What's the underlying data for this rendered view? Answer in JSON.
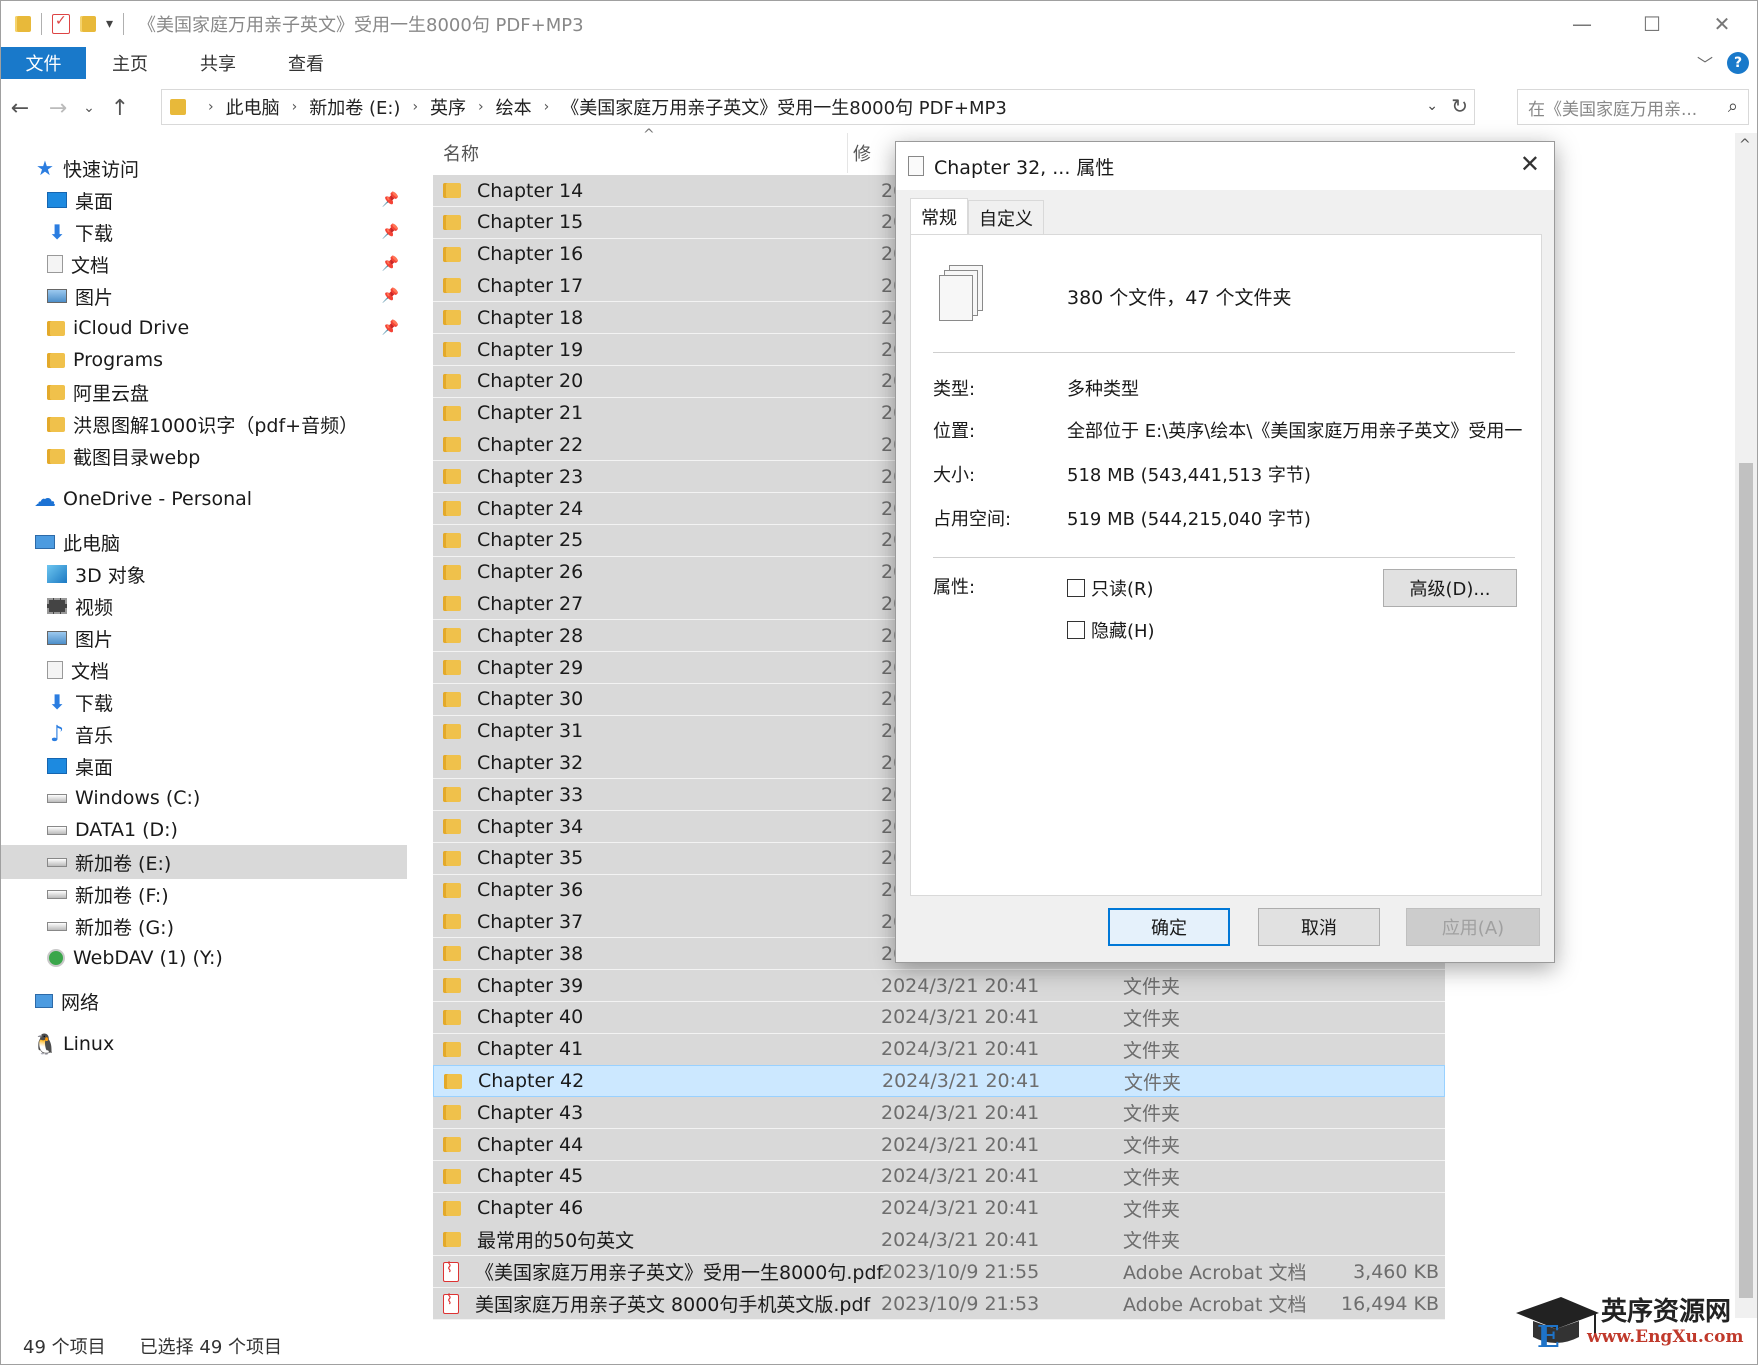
{
  "window": {
    "title": "《美国家庭万用亲子英文》受用一生8000句 PDF+MP3",
    "minimize": "—",
    "maximize": "☐",
    "close": "✕"
  },
  "ribbon": {
    "tabs": [
      "文件",
      "主页",
      "共享",
      "查看"
    ],
    "help": "?"
  },
  "address": {
    "crumbs": [
      "此电脑",
      "新加卷 (E:)",
      "英序",
      "绘本",
      "《美国家庭万用亲子英文》受用一生8000句 PDF+MP3"
    ],
    "search_placeholder": "在《美国家庭万用亲..."
  },
  "sidebar": {
    "items": [
      {
        "label": "快速访问",
        "icon": "star-icon",
        "pin": false,
        "indent": 0
      },
      {
        "label": "桌面",
        "icon": "desktop-icon",
        "pin": true,
        "indent": 1
      },
      {
        "label": "下载",
        "icon": "download-icon",
        "pin": true,
        "indent": 1
      },
      {
        "label": "文档",
        "icon": "document-icon",
        "pin": true,
        "indent": 1
      },
      {
        "label": "图片",
        "icon": "pictures-icon",
        "pin": true,
        "indent": 1
      },
      {
        "label": "iCloud Drive",
        "icon": "folder-icon",
        "pin": true,
        "indent": 1
      },
      {
        "label": "Programs",
        "icon": "folder-icon",
        "pin": false,
        "indent": 1
      },
      {
        "label": "阿里云盘",
        "icon": "folder-icon",
        "pin": false,
        "indent": 1
      },
      {
        "label": "洪恩图解1000识字（pdf+音频）",
        "icon": "folder-icon",
        "pin": false,
        "indent": 1
      },
      {
        "label": "截图目录webp",
        "icon": "folder-icon",
        "pin": false,
        "indent": 1
      },
      {
        "label": "OneDrive - Personal",
        "icon": "cloud-icon",
        "pin": false,
        "indent": 0
      },
      {
        "label": "此电脑",
        "icon": "computer-icon",
        "pin": false,
        "indent": 0
      },
      {
        "label": "3D 对象",
        "icon": "3d-objects-icon",
        "pin": false,
        "indent": 1
      },
      {
        "label": "视频",
        "icon": "video-icon",
        "pin": false,
        "indent": 1
      },
      {
        "label": "图片",
        "icon": "pictures-icon",
        "pin": false,
        "indent": 1
      },
      {
        "label": "文档",
        "icon": "document-icon",
        "pin": false,
        "indent": 1
      },
      {
        "label": "下载",
        "icon": "download-icon",
        "pin": false,
        "indent": 1
      },
      {
        "label": "音乐",
        "icon": "music-icon",
        "pin": false,
        "indent": 1
      },
      {
        "label": "桌面",
        "icon": "desktop-icon",
        "pin": false,
        "indent": 1
      },
      {
        "label": "Windows (C:)",
        "icon": "drive-icon",
        "pin": false,
        "indent": 1
      },
      {
        "label": "DATA1 (D:)",
        "icon": "drive-icon",
        "pin": false,
        "indent": 1
      },
      {
        "label": "新加卷 (E:)",
        "icon": "drive-icon",
        "pin": false,
        "indent": 1,
        "selected": true
      },
      {
        "label": "新加卷 (F:)",
        "icon": "drive-icon",
        "pin": false,
        "indent": 1
      },
      {
        "label": "新加卷 (G:)",
        "icon": "drive-icon",
        "pin": false,
        "indent": 1
      },
      {
        "label": "WebDAV (1) (Y:)",
        "icon": "network-drive-icon",
        "pin": false,
        "indent": 1
      },
      {
        "label": "网络",
        "icon": "network-icon",
        "pin": false,
        "indent": 0
      },
      {
        "label": "Linux",
        "icon": "linux-icon",
        "pin": false,
        "indent": 0
      }
    ]
  },
  "list": {
    "headers": {
      "name": "名称",
      "modified": "修"
    },
    "rows": [
      {
        "name": "Chapter 14",
        "date": "20",
        "type": "",
        "size": "",
        "kind": "folder"
      },
      {
        "name": "Chapter 15",
        "date": "20",
        "type": "",
        "size": "",
        "kind": "folder"
      },
      {
        "name": "Chapter 16",
        "date": "20",
        "type": "",
        "size": "",
        "kind": "folder"
      },
      {
        "name": "Chapter 17",
        "date": "20",
        "type": "",
        "size": "",
        "kind": "folder"
      },
      {
        "name": "Chapter 18",
        "date": "20",
        "type": "",
        "size": "",
        "kind": "folder"
      },
      {
        "name": "Chapter 19",
        "date": "20",
        "type": "",
        "size": "",
        "kind": "folder"
      },
      {
        "name": "Chapter 20",
        "date": "20",
        "type": "",
        "size": "",
        "kind": "folder"
      },
      {
        "name": "Chapter 21",
        "date": "20",
        "type": "",
        "size": "",
        "kind": "folder"
      },
      {
        "name": "Chapter 22",
        "date": "20",
        "type": "",
        "size": "",
        "kind": "folder"
      },
      {
        "name": "Chapter 23",
        "date": "20",
        "type": "",
        "size": "",
        "kind": "folder"
      },
      {
        "name": "Chapter 24",
        "date": "20",
        "type": "",
        "size": "",
        "kind": "folder"
      },
      {
        "name": "Chapter 25",
        "date": "20",
        "type": "",
        "size": "",
        "kind": "folder"
      },
      {
        "name": "Chapter 26",
        "date": "20",
        "type": "",
        "size": "",
        "kind": "folder"
      },
      {
        "name": "Chapter 27",
        "date": "20",
        "type": "",
        "size": "",
        "kind": "folder"
      },
      {
        "name": "Chapter 28",
        "date": "20",
        "type": "",
        "size": "",
        "kind": "folder"
      },
      {
        "name": "Chapter 29",
        "date": "20",
        "type": "",
        "size": "",
        "kind": "folder"
      },
      {
        "name": "Chapter 30",
        "date": "20",
        "type": "",
        "size": "",
        "kind": "folder"
      },
      {
        "name": "Chapter 31",
        "date": "20",
        "type": "",
        "size": "",
        "kind": "folder"
      },
      {
        "name": "Chapter 32",
        "date": "20",
        "type": "",
        "size": "",
        "kind": "folder"
      },
      {
        "name": "Chapter 33",
        "date": "20",
        "type": "",
        "size": "",
        "kind": "folder"
      },
      {
        "name": "Chapter 34",
        "date": "20",
        "type": "",
        "size": "",
        "kind": "folder"
      },
      {
        "name": "Chapter 35",
        "date": "20",
        "type": "",
        "size": "",
        "kind": "folder"
      },
      {
        "name": "Chapter 36",
        "date": "20",
        "type": "",
        "size": "",
        "kind": "folder"
      },
      {
        "name": "Chapter 37",
        "date": "20",
        "type": "",
        "size": "",
        "kind": "folder"
      },
      {
        "name": "Chapter 38",
        "date": "2024/3/21 20:41",
        "type": "文件夹",
        "size": "",
        "kind": "folder"
      },
      {
        "name": "Chapter 39",
        "date": "2024/3/21 20:41",
        "type": "文件夹",
        "size": "",
        "kind": "folder"
      },
      {
        "name": "Chapter 40",
        "date": "2024/3/21 20:41",
        "type": "文件夹",
        "size": "",
        "kind": "folder"
      },
      {
        "name": "Chapter 41",
        "date": "2024/3/21 20:41",
        "type": "文件夹",
        "size": "",
        "kind": "folder"
      },
      {
        "name": "Chapter 42",
        "date": "2024/3/21 20:41",
        "type": "文件夹",
        "size": "",
        "kind": "folder",
        "highlight": true
      },
      {
        "name": "Chapter 43",
        "date": "2024/3/21 20:41",
        "type": "文件夹",
        "size": "",
        "kind": "folder"
      },
      {
        "name": "Chapter 44",
        "date": "2024/3/21 20:41",
        "type": "文件夹",
        "size": "",
        "kind": "folder"
      },
      {
        "name": "Chapter 45",
        "date": "2024/3/21 20:41",
        "type": "文件夹",
        "size": "",
        "kind": "folder"
      },
      {
        "name": "Chapter 46",
        "date": "2024/3/21 20:41",
        "type": "文件夹",
        "size": "",
        "kind": "folder"
      },
      {
        "name": "最常用的50句英文",
        "date": "2024/3/21 20:41",
        "type": "文件夹",
        "size": "",
        "kind": "folder"
      },
      {
        "name": "《美国家庭万用亲子英文》受用一生8000句.pdf",
        "date": "2023/10/9 21:55",
        "type": "Adobe Acrobat 文档",
        "size": "3,460 KB",
        "kind": "pdf"
      },
      {
        "name": "美国家庭万用亲子英文 8000句手机英文版.pdf",
        "date": "2023/10/9 21:53",
        "type": "Adobe Acrobat 文档",
        "size": "16,494 KB",
        "kind": "pdf"
      }
    ]
  },
  "status": {
    "count": "49 个项目",
    "selected": "已选择 49 个项目"
  },
  "dialog": {
    "title": "Chapter 32, ... 属性",
    "tabs": [
      "常规",
      "自定义"
    ],
    "summary": "380 个文件，47 个文件夹",
    "labels": {
      "type": "类型:",
      "location": "位置:",
      "size": "大小:",
      "disk": "占用空间:",
      "attrs": "属性:"
    },
    "values": {
      "type": "多种类型",
      "location": "全部位于 E:\\英序\\绘本\\《美国家庭万用亲子英文》受用一",
      "size": "518 MB (543,441,513 字节)",
      "disk": "519 MB (544,215,040 字节)"
    },
    "readonly": "只读(R)",
    "hidden": "隐藏(H)",
    "advanced": "高级(D)...",
    "ok": "确定",
    "cancel": "取消",
    "apply": "应用(A)"
  },
  "watermark": {
    "text": "英序资源网",
    "url": "www.EngXu.com"
  }
}
